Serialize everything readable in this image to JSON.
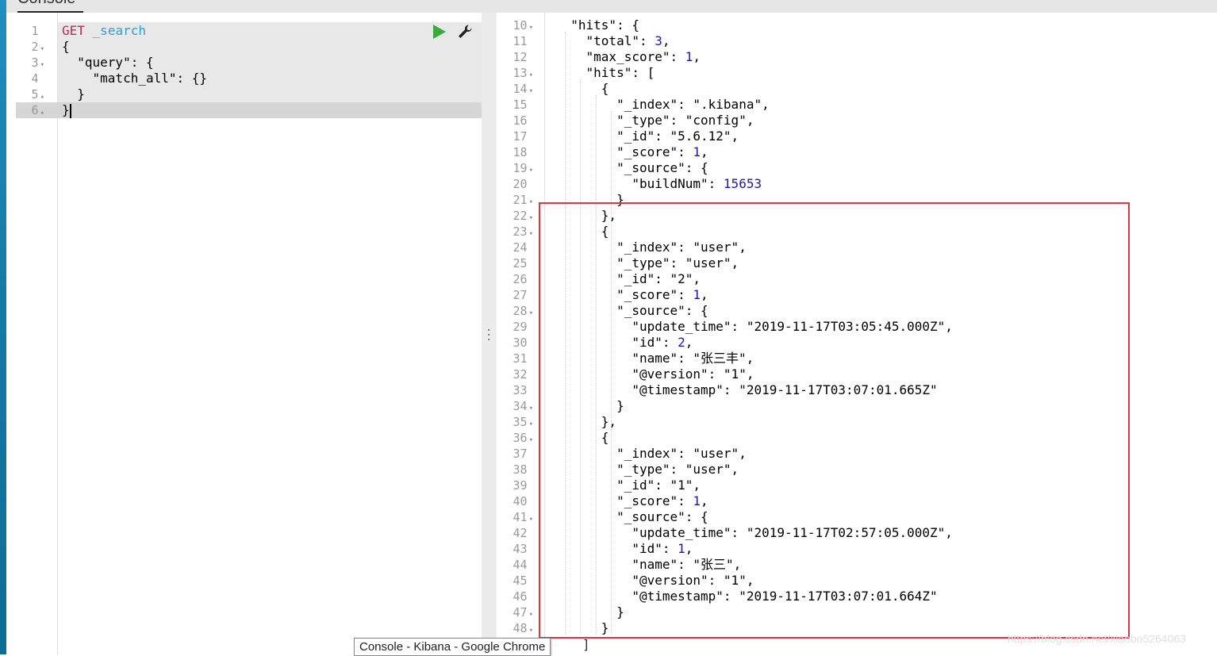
{
  "app": {
    "tab_label": "Console",
    "tooltip": "Console - Kibana - Google Chrome",
    "watermark": "https://blog.csdn.net/xiaobo5264063",
    "accent_color": "#3caa3c",
    "highlight_color": "#e0353b"
  },
  "request_editor": {
    "line_numbers": [
      "1",
      "2",
      "3",
      "4",
      "5",
      "6"
    ],
    "method": "GET",
    "url": "_search",
    "lines": [
      "{",
      "  \"query\": {",
      "    \"match_all\": {}",
      "  }",
      "}"
    ],
    "run_icon": "play-icon",
    "settings_icon": "wrench-icon"
  },
  "response_viewer": {
    "line_numbers": [
      "10",
      "11",
      "12",
      "13",
      "14",
      "15",
      "16",
      "17",
      "18",
      "19",
      "20",
      "21",
      "22",
      "23",
      "24",
      "25",
      "26",
      "27",
      "28",
      "29",
      "30",
      "31",
      "32",
      "33",
      "34",
      "35",
      "36",
      "37",
      "38",
      "39",
      "40",
      "41",
      "42",
      "43",
      "44",
      "45",
      "46",
      "47",
      "48"
    ],
    "lines": [
      "  \"hits\": {",
      "    \"total\": 3,",
      "    \"max_score\": 1,",
      "    \"hits\": [",
      "      {",
      "        \"_index\": \".kibana\",",
      "        \"_type\": \"config\",",
      "        \"_id\": \"5.6.12\",",
      "        \"_score\": 1,",
      "        \"_source\": {",
      "          \"buildNum\": 15653",
      "        }",
      "      },",
      "      {",
      "        \"_index\": \"user\",",
      "        \"_type\": \"user\",",
      "        \"_id\": \"2\",",
      "        \"_score\": 1,",
      "        \"_source\": {",
      "          \"update_time\": \"2019-11-17T03:05:45.000Z\",",
      "          \"id\": 2,",
      "          \"name\": \"张三丰\",",
      "          \"@version\": \"1\",",
      "          \"@timestamp\": \"2019-11-17T03:07:01.665Z\"",
      "        }",
      "      },",
      "      {",
      "        \"_index\": \"user\",",
      "        \"_type\": \"user\",",
      "        \"_id\": \"1\",",
      "        \"_score\": 1,",
      "        \"_source\": {",
      "          \"update_time\": \"2019-11-17T02:57:05.000Z\",",
      "          \"id\": 1,",
      "          \"name\": \"张三\",",
      "          \"@version\": \"1\",",
      "          \"@timestamp\": \"2019-11-17T03:07:01.664Z\"",
      "        }",
      "      }"
    ],
    "fold_lines": [
      "10",
      "13",
      "14",
      "19",
      "21",
      "22",
      "23",
      "28",
      "34",
      "35",
      "36",
      "41",
      "47",
      "48"
    ],
    "trailing_bracket": "]"
  }
}
